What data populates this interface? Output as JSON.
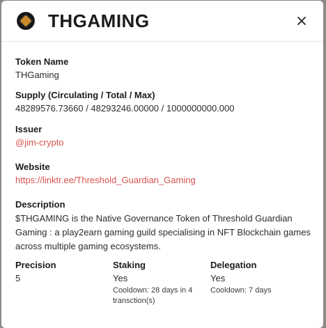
{
  "header": {
    "title": "THGAMING",
    "logo_icon": "thgaming-logo-icon",
    "close_icon": "close-icon"
  },
  "fields": {
    "token_name": {
      "label": "Token Name",
      "value": "THGaming"
    },
    "supply": {
      "label": "Supply (Circulating / Total / Max)",
      "value": "48289576.73660 / 48293246.00000 / 1000000000.000"
    },
    "issuer": {
      "label": "Issuer",
      "value": "@jim-crypto"
    },
    "website": {
      "label": "Website",
      "value": "https://linktr.ee/Threshold_Guardian_Gaming"
    },
    "description": {
      "label": "Description",
      "value": "$THGAMING is the Native Governance Token of Threshold Guardian Gaming : a play2earn gaming guild specialising in NFT Blockchain games across multiple gaming ecosystems."
    },
    "precision": {
      "label": "Precision",
      "value": "5"
    },
    "staking": {
      "label": "Staking",
      "value": "Yes",
      "note": "Cooldown: 28 days in 4 transction(s)"
    },
    "delegation": {
      "label": "Delegation",
      "value": "Yes",
      "note": "Cooldown: 7 days"
    }
  },
  "colors": {
    "link": "#d9534f",
    "backdrop": "#8a8a8a",
    "text": "#1b1b1b"
  }
}
